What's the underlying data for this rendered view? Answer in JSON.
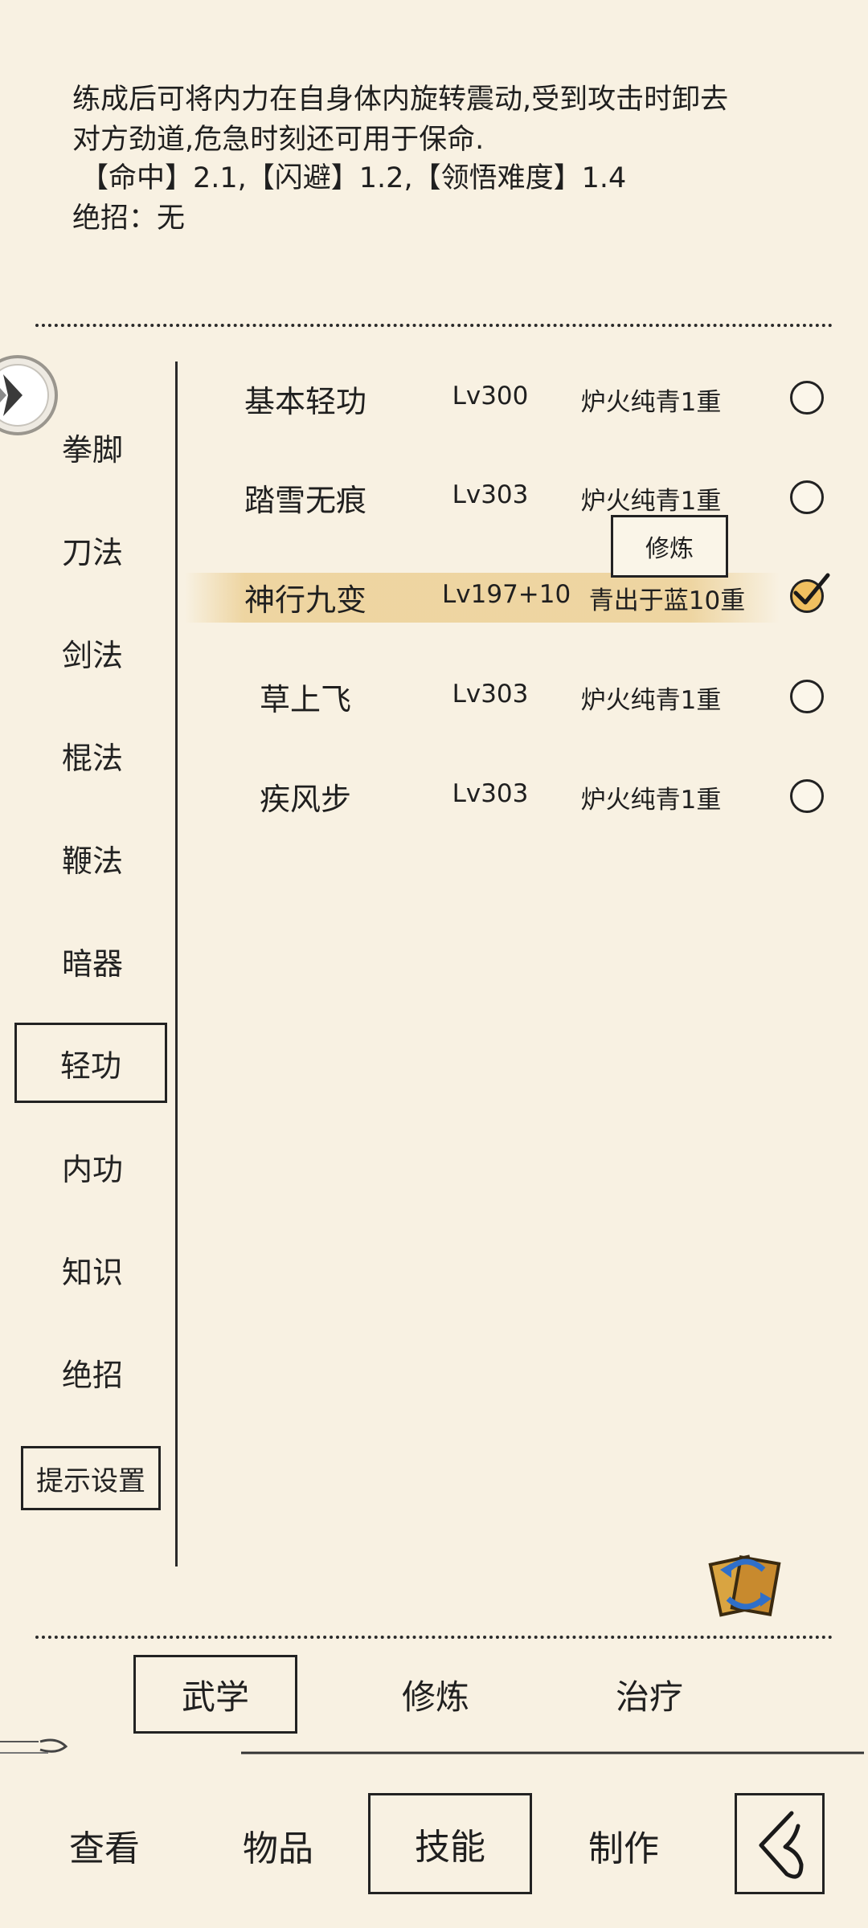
{
  "description": {
    "line1": "练成后可将内力在自身体内旋转震动,受到攻击时卸去",
    "line2": "对方劲道,危急时刻还可用于保命.",
    "line3": "【命中】2.1,【闪避】1.2,【领悟难度】1.4",
    "line4": "绝招：无"
  },
  "sidebar": {
    "items": [
      {
        "label": "拳脚"
      },
      {
        "label": "刀法"
      },
      {
        "label": "剑法"
      },
      {
        "label": "棍法"
      },
      {
        "label": "鞭法"
      },
      {
        "label": "暗器"
      },
      {
        "label": "轻功"
      },
      {
        "label": "内功"
      },
      {
        "label": "知识"
      },
      {
        "label": "绝招"
      }
    ],
    "selected": "轻功",
    "hint_settings": "提示设置"
  },
  "skills": [
    {
      "name": "基本轻功",
      "level": "Lv300",
      "realm": "炉火纯青1重",
      "checked": false
    },
    {
      "name": "踏雪无痕",
      "level": "Lv303",
      "realm": "炉火纯青1重",
      "checked": false
    },
    {
      "name": "神行九变",
      "level": "Lv197+10",
      "realm": "青出于蓝10重",
      "checked": true
    },
    {
      "name": "草上飞",
      "level": "Lv303",
      "realm": "炉火纯青1重",
      "checked": false
    },
    {
      "name": "疾风步",
      "level": "Lv303",
      "realm": "炉火纯青1重",
      "checked": false
    }
  ],
  "practice_popup": "修炼",
  "tabs": {
    "martial": "武学",
    "practice": "修炼",
    "heal": "治疗"
  },
  "bottom_nav": {
    "view": "查看",
    "items": "物品",
    "skills": "技能",
    "craft": "制作"
  }
}
